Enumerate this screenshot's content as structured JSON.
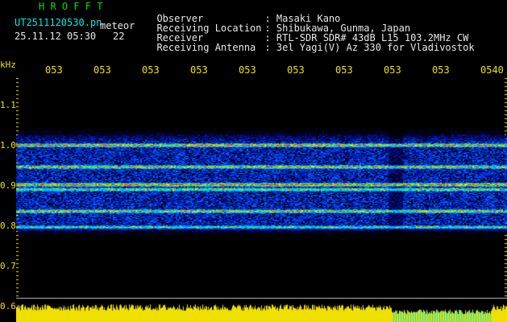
{
  "header": {
    "title": "H R O F F T",
    "filename": "UT2511120530.pn",
    "meteor_label": "meteor",
    "datetime": "25.11.12 05:30",
    "count": "22"
  },
  "info": {
    "rows": [
      {
        "label": "Observer",
        "value": ": Masaki Kano"
      },
      {
        "label": "Receiving Location",
        "value": ": Shibukawa, Gunma, Japan"
      },
      {
        "label": "Receiver",
        "value": ": RTL-SDR SDR# 43dB L15 103.2MHz CW"
      },
      {
        "label": "Receiving Antenna",
        "value": ": 3el Yagi(V) Az 330 for Vladivostok"
      }
    ]
  },
  "axes": {
    "y_unit": "kHz",
    "y_ticks": [
      "1.1",
      "1.0",
      "0.9",
      "0.8",
      "0.7",
      "0.6"
    ],
    "x_ticks": [
      "053",
      "053",
      "053",
      "053",
      "053",
      "053",
      "053",
      "053",
      "053",
      "0540"
    ]
  },
  "colors": {
    "background": "#000000",
    "title": "#00e000",
    "filename": "#00e8e8",
    "axis": "#f0e000",
    "text": "#e8e8e8"
  }
}
